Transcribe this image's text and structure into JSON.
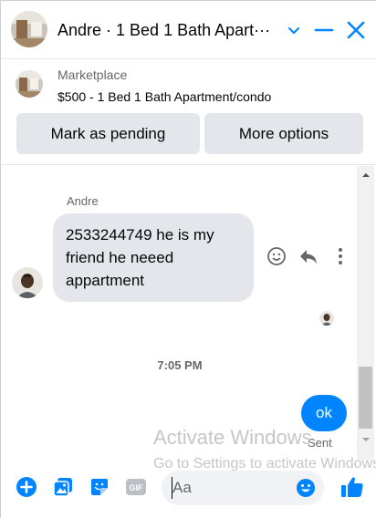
{
  "header": {
    "title": "Andre · 1 Bed 1 Bath Apart···"
  },
  "marketplace": {
    "label": "Marketplace",
    "listing": "$500 - 1 Bed 1 Bath Apartment/condo",
    "mark_pending_label": "Mark as pending",
    "more_options_label": "More options"
  },
  "thread": {
    "sender_name": "Andre",
    "incoming_message_lines": [
      "2533244749 he is my",
      "friend he neeed",
      "appartment"
    ],
    "timestamp": "7:05 PM",
    "outgoing_message": "ok",
    "outgoing_status": "Sent"
  },
  "watermark": {
    "line1": "Activate Windows",
    "line2": "Go to Settings to activate Windows."
  },
  "composer": {
    "placeholder": "Aa"
  },
  "colors": {
    "accent": "#0084ff",
    "bubble_gray": "#e4e6eb",
    "secondary_text": "#65676b"
  },
  "icons": [
    "apartment-thumbnail",
    "chevron-down-icon",
    "minimize-icon",
    "close-icon",
    "smiley-icon",
    "reply-icon",
    "more-icon",
    "plus-circle-icon",
    "image-icon",
    "sticker-icon",
    "gif-icon",
    "emoji-icon",
    "like-icon"
  ]
}
